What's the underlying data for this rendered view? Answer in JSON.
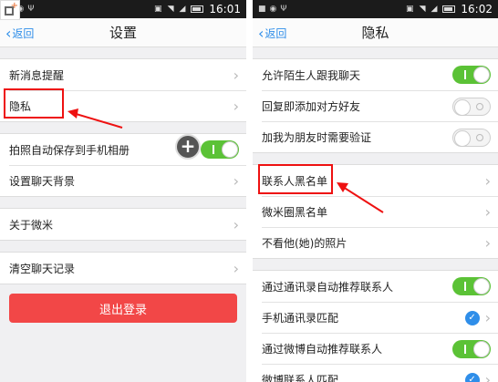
{
  "left": {
    "status_time": "16:01",
    "back": "返回",
    "title": "设置",
    "group1": [
      "新消息提醒",
      "隐私"
    ],
    "group2": [
      "拍照自动保存到手机相册",
      "设置聊天背景"
    ],
    "group3": [
      "关于微米"
    ],
    "group4": [
      "清空聊天记录"
    ],
    "logout": "退出登录"
  },
  "right": {
    "status_time": "16:02",
    "back": "返回",
    "title": "隐私",
    "group1": [
      "允许陌生人跟我聊天",
      "回复即添加对方好友",
      "加我为朋友时需要验证"
    ],
    "group2": [
      "联系人黑名单",
      "微米圈黑名单",
      "不看他(她)的照片"
    ],
    "group3": [
      "通过通讯录自动推荐联系人",
      "手机通讯录匹配",
      "通过微博自动推荐联系人",
      "微博联系人匹配"
    ]
  },
  "colors": {
    "accent": "#2f8ee9",
    "toggle_on": "#5bc236",
    "danger": "#f24747",
    "annotation": "#e11111"
  },
  "icons": {
    "back": "chevron-left-icon",
    "row_arrow": "chevron-right-icon",
    "check": "check-circle-icon",
    "plus": "plus-circle-icon"
  }
}
